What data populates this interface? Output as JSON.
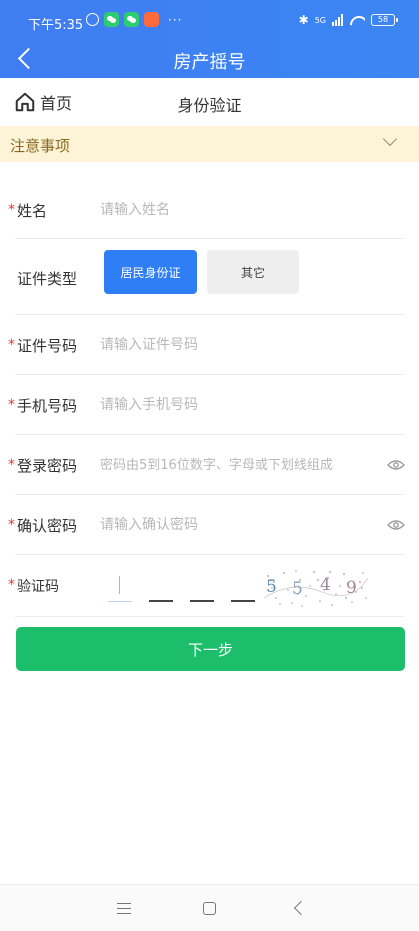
{
  "status_bar": {
    "time": "下午5:35",
    "more": "···",
    "network": "5G",
    "battery": "58"
  },
  "header": {
    "title": "房产摇号"
  },
  "nav": {
    "home_label": "首页",
    "subtitle": "身份验证"
  },
  "notice": {
    "label": "注意事项"
  },
  "form": {
    "name": {
      "label": "姓名",
      "placeholder": "请输入姓名",
      "value": ""
    },
    "id_type": {
      "label": "证件类型",
      "options": [
        "居民身份证",
        "其它"
      ],
      "selected": "居民身份证"
    },
    "id_number": {
      "label": "证件号码",
      "placeholder": "请输入证件号码",
      "value": ""
    },
    "phone": {
      "label": "手机号码",
      "placeholder": "请输入手机号码",
      "value": ""
    },
    "password": {
      "label": "登录密码",
      "placeholder": "密码由5到16位数字、字母或下划线组成",
      "value": ""
    },
    "confirm_password": {
      "label": "确认密码",
      "placeholder": "请输入确认密码",
      "value": ""
    },
    "captcha": {
      "label": "验证码",
      "image_code": "5549",
      "digits": 4
    },
    "required_mark": "*"
  },
  "next_button": "下一步",
  "colors": {
    "primary": "#3b82f6",
    "next_button": "#1cbe6b",
    "required": "#e53935",
    "notice_bg": "#fdf4d8"
  }
}
